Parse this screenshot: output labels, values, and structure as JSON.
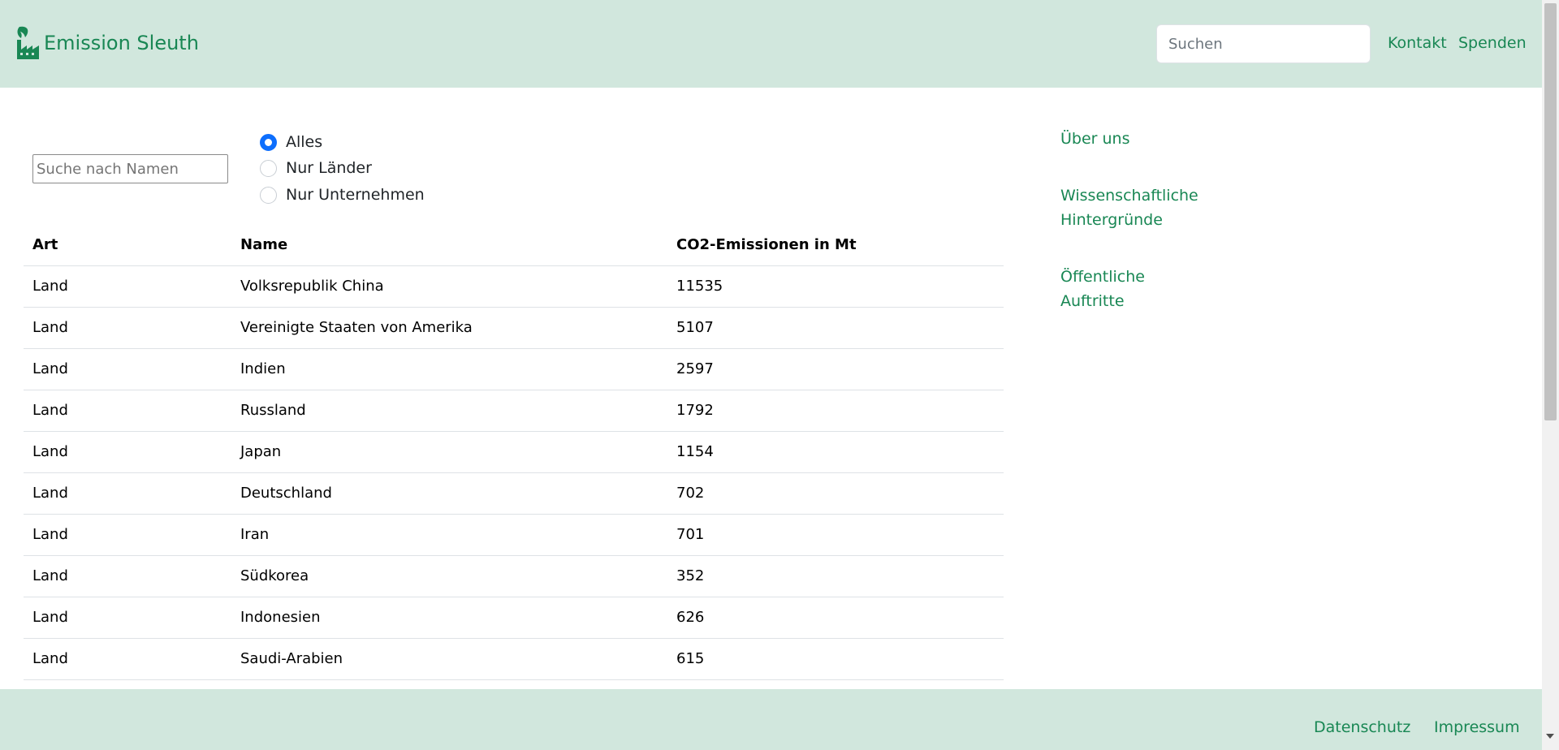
{
  "header": {
    "brand": "Emission Sleuth",
    "search_placeholder": "Suchen",
    "links": [
      "Kontakt",
      "Spenden"
    ]
  },
  "filters": {
    "name_placeholder": "Suche nach Namen",
    "options": [
      "Alles",
      "Nur Länder",
      "Nur Unternehmen"
    ],
    "selected": "Alles"
  },
  "table": {
    "headers": [
      "Art",
      "Name",
      "CO2-Emissionen in Mt"
    ],
    "rows": [
      [
        "Land",
        "Volksrepublik China",
        "11535"
      ],
      [
        "Land",
        "Vereinigte Staaten von Amerika",
        "5107"
      ],
      [
        "Land",
        "Indien",
        "2597"
      ],
      [
        "Land",
        "Russland",
        "1792"
      ],
      [
        "Land",
        "Japan",
        "1154"
      ],
      [
        "Land",
        "Deutschland",
        "702"
      ],
      [
        "Land",
        "Iran",
        "701"
      ],
      [
        "Land",
        "Südkorea",
        "352"
      ],
      [
        "Land",
        "Indonesien",
        "626"
      ],
      [
        "Land",
        "Saudi-Arabien",
        "615"
      ]
    ]
  },
  "sidebar": {
    "links": [
      [
        "Über uns"
      ],
      [
        "Wissenschaftliche",
        "Hintergründe"
      ],
      [
        "Öffentliche",
        "Auftritte"
      ]
    ]
  },
  "footer": {
    "links": [
      "Datenschutz",
      "Impressum"
    ]
  },
  "colors": {
    "brand_green": "#198754",
    "header_bg": "#d1e7dd",
    "radio_accent": "#0d6efd"
  },
  "icons": {
    "brand_logo": "factory-leaf-icon"
  }
}
